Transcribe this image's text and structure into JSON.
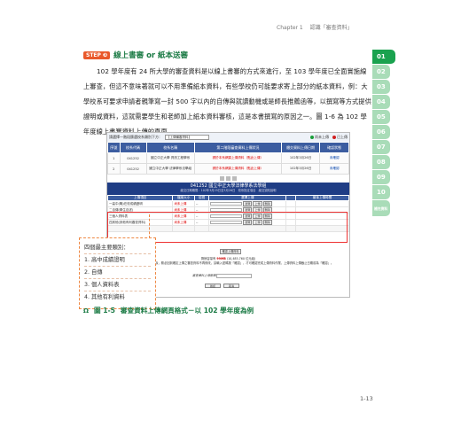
{
  "header": {
    "chapter": "Chapter 1",
    "title": "認識「審查資料」"
  },
  "sidebar": [
    "01",
    "02",
    "03",
    "04",
    "05",
    "06",
    "07",
    "08",
    "09",
    "10",
    "補充資料"
  ],
  "section": {
    "step": "STEP",
    "number": "❸",
    "title": "線上書審 or 紙本送審"
  },
  "paragraph": "102 學年度有 24 所大學的審查資料是以線上書審的方式來進行，至 103 學年度已全面實施線上審查，但這不意味著就可以不用準備紙本資料，有些學校仍可能要求寄上部分的紙本資料，例：大學校系可要求申請者親筆寫一封 500 字以內的自傳與就讀動機或是師長推薦函等，以撰寫等方式提供證明或資料，這就需要學生和老師加上紙本資料審核，這是本書撰寫的原因之一。圖 1-6 為 102 學年度線上書審資料上傳的頁面。",
  "screenshot": {
    "toolbar": {
      "prompt": "請選擇一階段篩選校系類別下方：",
      "select": "【上傳備審資料】",
      "legend": [
        {
          "label": "尚未上傳",
          "color": "#1a9e3a"
        },
        {
          "label": "已上傳",
          "color": "#d02020"
        }
      ]
    },
    "table1": {
      "headers": [
        "序號",
        "校系代碼",
        "校系名稱",
        "第二階段審查資料上傳狀況",
        "繳交資料上傳日期",
        "確認狀態"
      ],
      "rows": [
        [
          "1",
          "041252",
          "國立中正大學\n資訊工程學系",
          "請於本系網頁上傳資料（點此上傳）",
          "102年3月26日",
          "未確認"
        ],
        [
          "2",
          "041252",
          "國立中正大學\n法律學系法學組",
          "請於本系網頁上傳資料（點此上傳）",
          "102年3月26日",
          "未確認"
        ]
      ]
    },
    "detail": {
      "title": "041252 國立中正大學法律學系法學組",
      "subtitle": "繳交日期期限：102年3月25日至3月26日　校系指定項目　繳交須知說明"
    },
    "table2": {
      "headers": [
        "上傳項目",
        "檔案大小",
        "檢視",
        "選擇上傳",
        "",
        "最後上傳時間"
      ],
      "rows": [
        [
          "一高中(職)在校成績證明",
          "尚未上傳",
          "--",
          "瀏覽",
          "上傳",
          "刪除"
        ],
        [
          "二自傳(學生自述)",
          "尚未上傳",
          "--",
          "瀏覽",
          "上傳",
          "刪除"
        ],
        [
          "三個人資料表",
          "尚未上傳",
          "--",
          "瀏覽",
          "上傳",
          "刪除"
        ],
        [
          "四其他(其他有利審查資料)",
          "尚未上傳",
          "--",
          "瀏覽",
          "上傳",
          "刪除"
        ]
      ]
    },
    "upload_btn": "確認上傳資料",
    "instr1": "剩餘容量有 ",
    "instr1_val": "99MB",
    "instr1_tail": " (10,485,760 位元組)",
    "instr2": "請注意：於完成上傳作業後，務必回到確定上傳之審查資料不再修改，請輸入密碼按「確認」，才可確認完成上傳資料作業，上傳資料上傳截止日期前為「確認」。",
    "pwd_label": "審查資料上傳密碼",
    "pwd_btns": [
      "確認",
      "取消"
    ]
  },
  "callout": {
    "title": "四個最主要類別：",
    "items": [
      "1. 高中成績證明",
      "2. 自傳",
      "3. 個人資料表",
      "4. 其他有利資料"
    ]
  },
  "caption": {
    "icon": "Ω",
    "label": "圖 1-5",
    "text": "審查資料上傳網頁格式－以 102 學年度為例"
  },
  "page_number": "1-13"
}
